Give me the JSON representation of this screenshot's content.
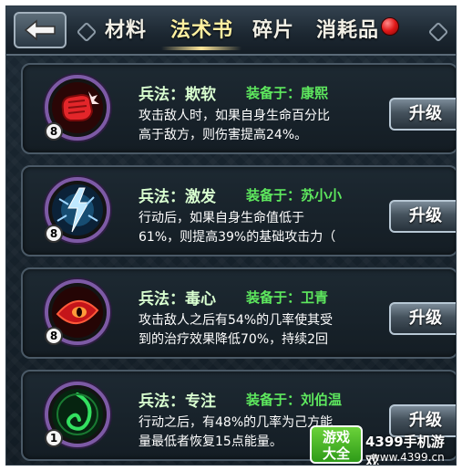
{
  "tabs": [
    {
      "label": "材料",
      "active": false
    },
    {
      "label": "法术书",
      "active": true
    },
    {
      "label": "碎片",
      "active": false
    },
    {
      "label": "消耗品",
      "active": false
    }
  ],
  "skills": [
    {
      "name": "兵法：欺软",
      "equip": "装备于：康熙",
      "desc_lines": [
        "攻击敌人时，如果自身生命百分比",
        "高于敌方，则伤害提高24%。"
      ],
      "level": "8",
      "icon": "red-fist-icon",
      "button": "升级"
    },
    {
      "name": "兵法：激发",
      "equip": "装备于：苏小小",
      "desc_lines": [
        "行动后，如果自身生命值低于",
        "61%，则提高39%的基础攻击力（"
      ],
      "level": "8",
      "icon": "lightning-icon",
      "button": "升级"
    },
    {
      "name": "兵法：毒心",
      "equip": "装备于：卫青",
      "desc_lines": [
        "攻击敌人之后有54%的几率使其受",
        "到的治疗效果降低70%，持续2回"
      ],
      "level": "8",
      "icon": "red-eye-icon",
      "button": "升级"
    },
    {
      "name": "兵法：专注",
      "equip": "装备于：刘伯温",
      "desc_lines": [
        "行动之后，有48%的几率为己方能",
        "量最低者恢复15点能量。"
      ],
      "level": "1",
      "icon": "green-swirl-icon",
      "button": "升级"
    }
  ],
  "watermark": {
    "logo_line1": "游戏",
    "logo_line2": "大全",
    "brand": "4399手机游戏",
    "url": "www.4399.cn"
  },
  "colors": {
    "equip_green": "#5ee85e",
    "icon_ring_purple": "#7d5aa5",
    "notif_red": "#e11818"
  }
}
